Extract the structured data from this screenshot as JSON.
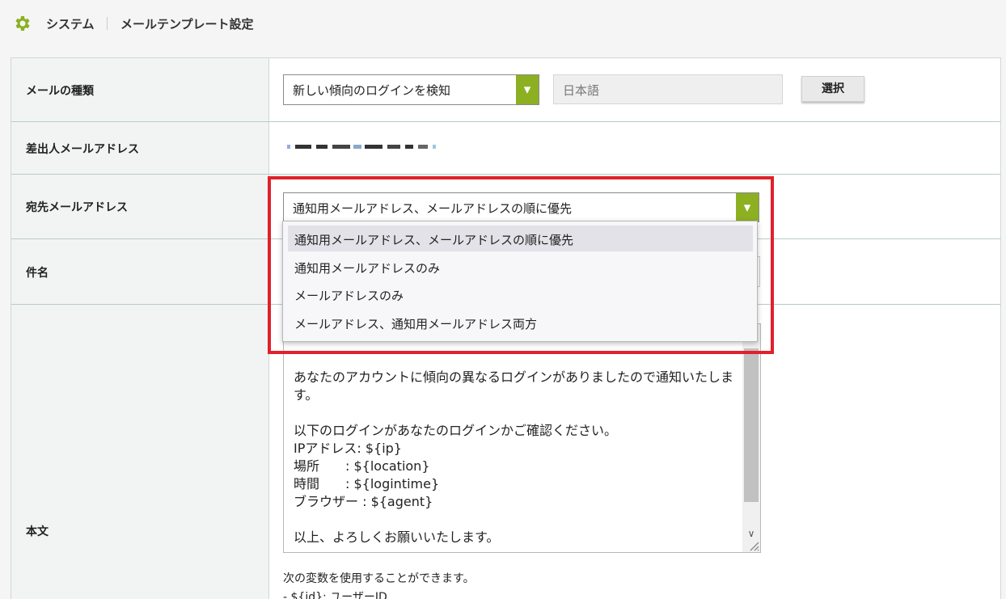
{
  "breadcrumb": {
    "icon": "gear-icon",
    "icon_color": "#8cb022",
    "section": "システム",
    "page": "メールテンプレート設定"
  },
  "form": {
    "mail_type": {
      "label": "メールの種類",
      "value": "新しい傾向のログインを検知",
      "language_value": "日本語",
      "select_button": "選択"
    },
    "sender": {
      "label": "差出人メールアドレス"
    },
    "recipient": {
      "label": "宛先メールアドレス",
      "value": "通知用メールアドレス、メールアドレスの順に優先",
      "options": [
        "通知用メールアドレス、メールアドレスの順に優先",
        "通知用メールアドレスのみ",
        "メールアドレスのみ",
        "メールアドレス、通知用メールアドレス両方"
      ]
    },
    "subject": {
      "label": "件名"
    },
    "body": {
      "label": "本文",
      "lines": [
        "あなたのアカウントに傾向の異なるログインがありましたので通知いたしま",
        "す。",
        "",
        "以下のログインがあなたのログインかご確認ください。",
        "IPアドレス: ${ip}",
        "場所　　: ${location}",
        "時間　　: ${logintime}",
        "ブラウザー : ${agent}",
        "",
        "以上、よろしくお願いいたします。"
      ],
      "vars_hint": "次の変数を使用することができます。",
      "vars_first": "- ${id}: ユーザーID"
    }
  },
  "colors": {
    "accent": "#8cb022",
    "highlight": "#e0212b"
  }
}
